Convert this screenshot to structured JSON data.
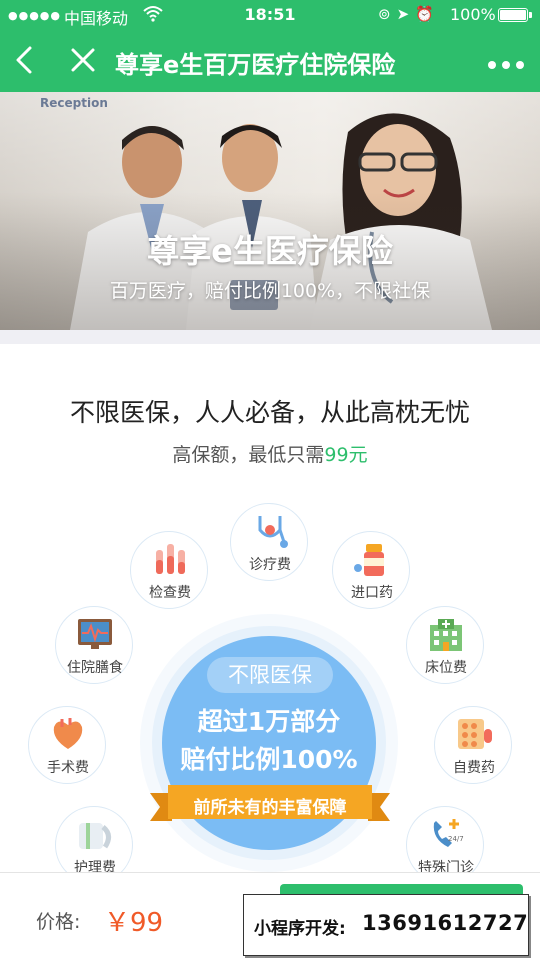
{
  "status_bar": {
    "carrier": "中国移动",
    "time": "18:51",
    "battery": "100%",
    "signal_dots": "●●●●●"
  },
  "nav": {
    "title": "尊享e生百万医疗住院保险"
  },
  "banner": {
    "sign": "Reception",
    "headline": "尊享e生医疗保险",
    "subline": "百万医疗，赔付比例100%，不限社保"
  },
  "intro": {
    "tagline": "不限医保，人人必备，从此高枕无忧",
    "subtag_prefix": "高保额，最低只需",
    "subtag_price": "99元"
  },
  "coverage": {
    "center_pill": "不限医保",
    "center_line1": "超过1万部分",
    "center_line2": "赔付比例100%",
    "ribbon": "前所未有的丰富保障",
    "items": [
      {
        "label": "诊疗费",
        "icon": "stethoscope-icon"
      },
      {
        "label": "检查费",
        "icon": "test-tubes-icon"
      },
      {
        "label": "进口药",
        "icon": "medicine-bottle-icon"
      },
      {
        "label": "住院膳食",
        "icon": "monitor-ecg-icon"
      },
      {
        "label": "床位费",
        "icon": "hospital-building-icon"
      },
      {
        "label": "手术费",
        "icon": "heart-icon"
      },
      {
        "label": "自费药",
        "icon": "pill-pack-icon"
      },
      {
        "label": "护理费",
        "icon": "bandage-icon"
      },
      {
        "label": "特殊门诊",
        "icon": "phone-24-7-icon"
      }
    ]
  },
  "bottom": {
    "price_label": "价格:",
    "price_value": "￥99",
    "dev_label": "小程序开发:",
    "dev_number": "13691612727"
  },
  "colors": {
    "brand_green": "#2dbe6c",
    "price_orange": "#f05a28",
    "core_blue": "#7bbcf4",
    "ribbon_orange": "#f5a623"
  }
}
